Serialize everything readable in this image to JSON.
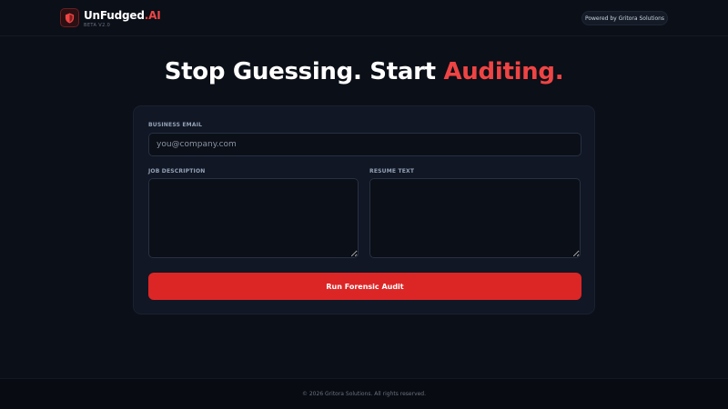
{
  "header": {
    "brand_main": "UnFudged",
    "brand_accent": ".AI",
    "beta": "BETA V2.0",
    "powered_by": "Powered by Gritora Solutions"
  },
  "hero": {
    "text_main": "Stop Guessing. Start ",
    "text_accent": "Auditing."
  },
  "form": {
    "email_label": "BUSINESS EMAIL",
    "email_placeholder": "you@company.com",
    "email_value": "",
    "job_label": "JOB DESCRIPTION",
    "job_value": "",
    "resume_label": "RESUME TEXT",
    "resume_value": "",
    "submit_label": "Run Forensic Audit"
  },
  "footer": {
    "copyright": "© 2026 Gritora Solutions. All rights reserved."
  },
  "colors": {
    "accent": "#ef4444",
    "button": "#dc2626",
    "background": "#0b0f17",
    "card": "#111724"
  },
  "icons": {
    "logo": "shield-icon"
  }
}
